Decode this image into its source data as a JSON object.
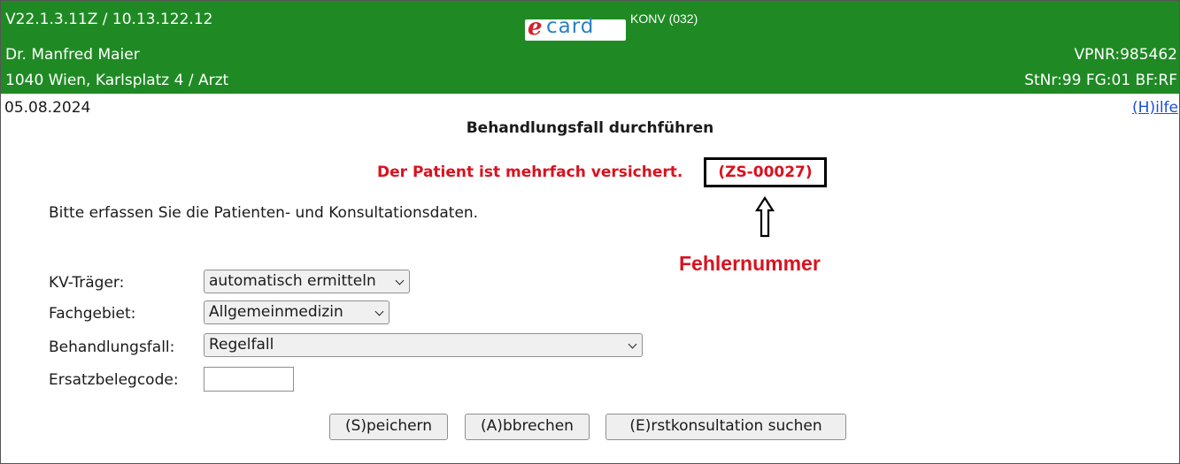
{
  "header": {
    "version_ip": "V22.1.3.11Z / 10.13.122.12",
    "logo": {
      "e": "e",
      "rest": "card"
    },
    "mode": "KONV (032)",
    "user_name": "Dr. Manfred Maier",
    "vpnr": "VPNR:985462",
    "address": "1040 Wien, Karlsplatz 4 / Arzt",
    "station_info": "StNr:99 FG:01 BF:RF"
  },
  "date": "05.08.2024",
  "help_link": "(H)ilfe",
  "page_title": "Behandlungsfall durchführen",
  "message": {
    "text": "Der Patient ist mehrfach versichert.",
    "code": "(ZS-00027)",
    "annotation": "Fehlernummer"
  },
  "intro": "Bitte erfassen Sie die Patienten- und Konsultationsdaten.",
  "form": {
    "kv_traeger": {
      "label": "KV-Träger:",
      "value": "automatisch ermitteln"
    },
    "fachgebiet": {
      "label": "Fachgebiet:",
      "value": "Allgemeinmedizin"
    },
    "behandlungsfall": {
      "label": "Behandlungsfall:",
      "value": "Regelfall"
    },
    "ersatzbelegcode": {
      "label": "Ersatzbelegcode:",
      "value": ""
    }
  },
  "buttons": {
    "save": "(S)peichern",
    "cancel": "(A)bbrechen",
    "search": "(E)rstkonsultation suchen"
  },
  "colors": {
    "header_green": "#1f8a24",
    "error_red": "#d9121f",
    "link_blue": "#1a4fd6"
  }
}
